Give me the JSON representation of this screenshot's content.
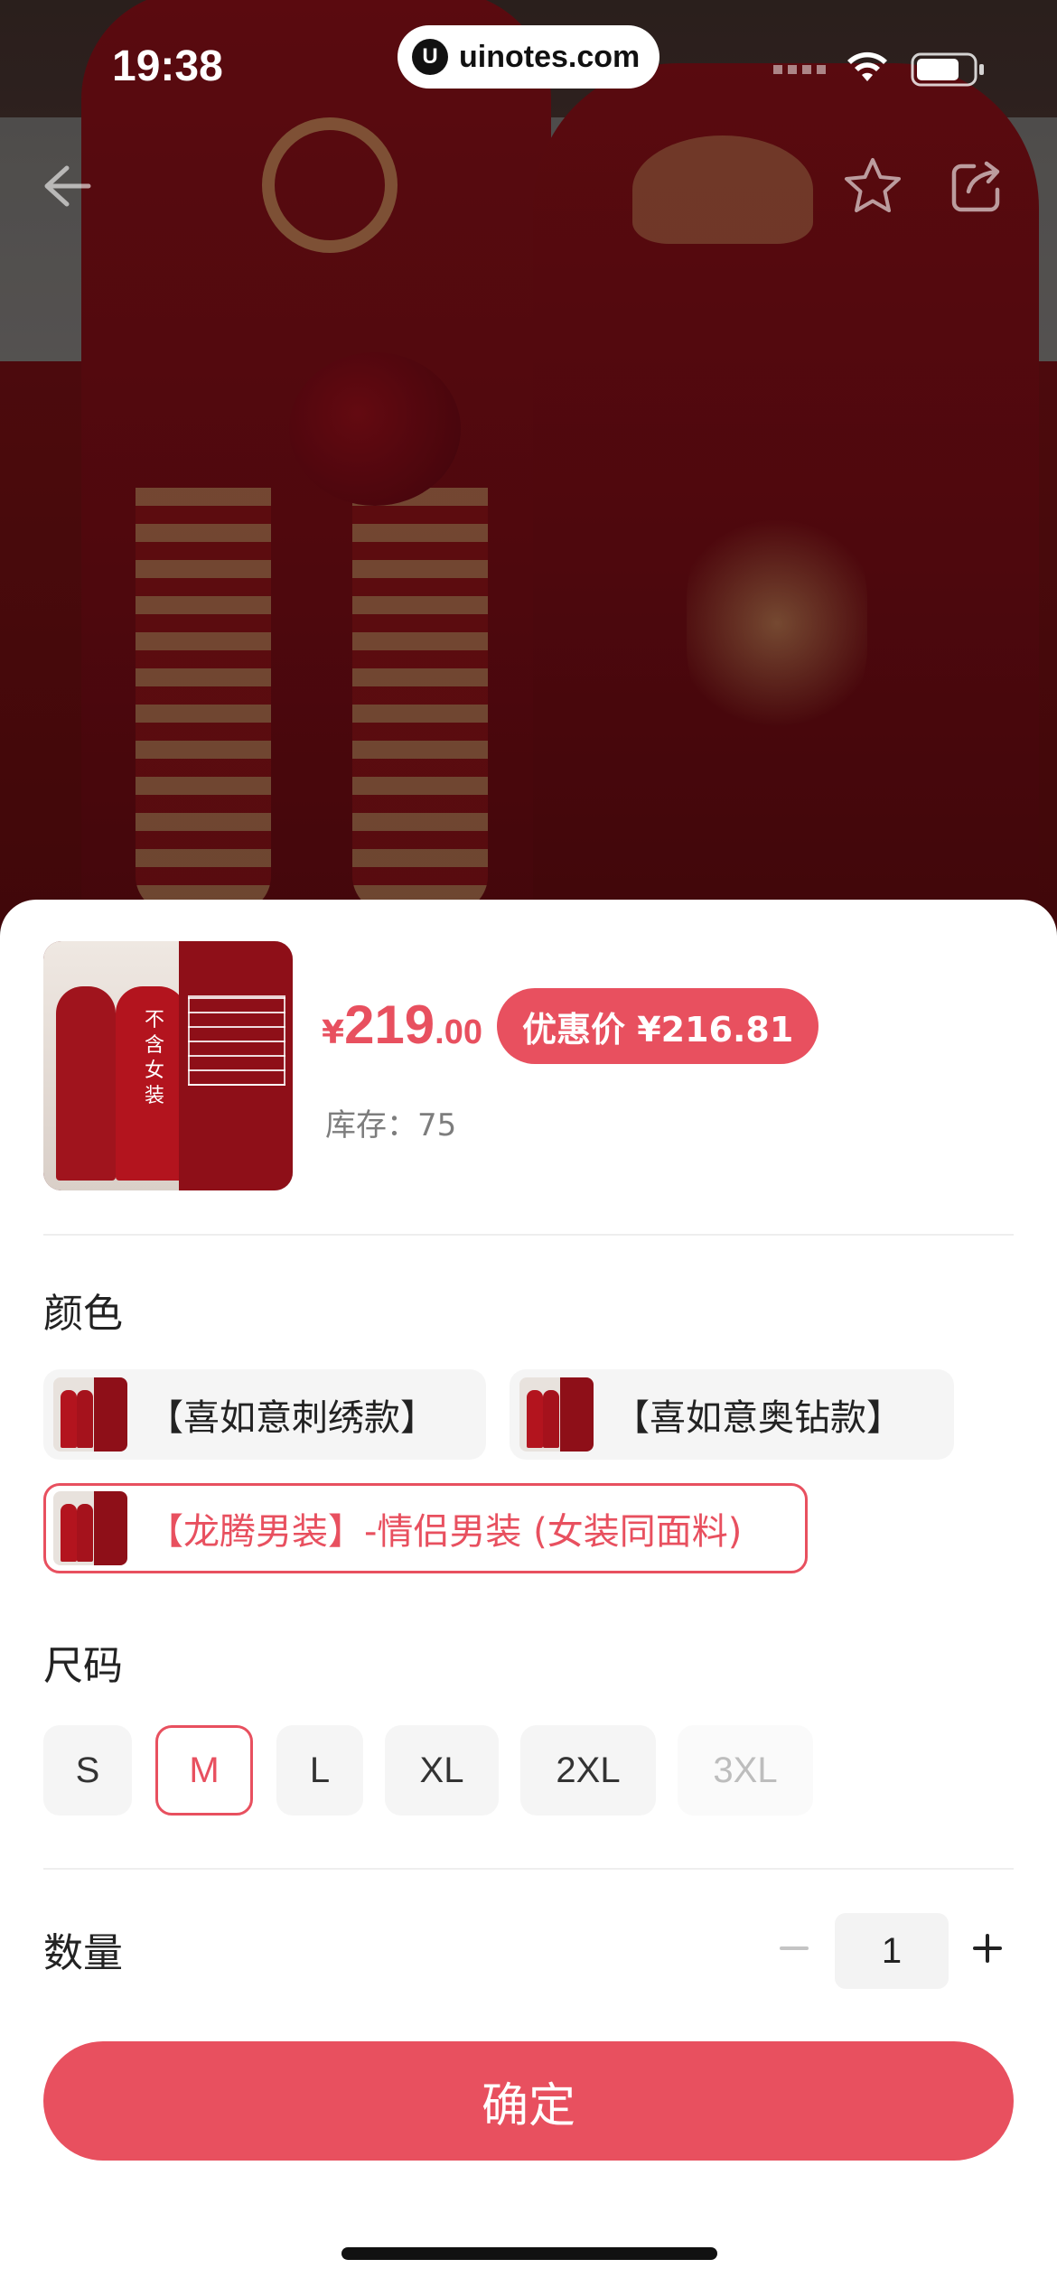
{
  "status_bar": {
    "time": "19:38",
    "url": "uinotes.com",
    "url_logo": "U"
  },
  "nav": {
    "back_icon": "arrow-left-icon",
    "favorite_icon": "star-icon",
    "share_icon": "share-icon"
  },
  "product": {
    "thumbnail_tag": "不含女装",
    "price_symbol": "¥",
    "price_integer": "219",
    "price_decimal": ".00",
    "promo_label": "优惠价 ¥216.81",
    "stock_label": "库存：75"
  },
  "color_section": {
    "title": "颜色",
    "options": [
      {
        "label": "【喜如意刺绣款】",
        "selected": false
      },
      {
        "label": "【喜如意奥钻款】",
        "selected": false
      },
      {
        "label": "【龙腾男装】-情侣男装 (女装同面料)",
        "selected": true
      }
    ]
  },
  "size_section": {
    "title": "尺码",
    "options": [
      {
        "label": "S",
        "state": "normal"
      },
      {
        "label": "M",
        "state": "selected"
      },
      {
        "label": "L",
        "state": "normal"
      },
      {
        "label": "XL",
        "state": "normal"
      },
      {
        "label": "2XL",
        "state": "normal"
      },
      {
        "label": "3XL",
        "state": "disabled"
      }
    ]
  },
  "quantity": {
    "label": "数量",
    "value": "1"
  },
  "confirm_label": "确定",
  "colors": {
    "accent": "#e8505f",
    "chip_bg": "#f5f5f5",
    "muted_text": "#7d7d7d"
  }
}
